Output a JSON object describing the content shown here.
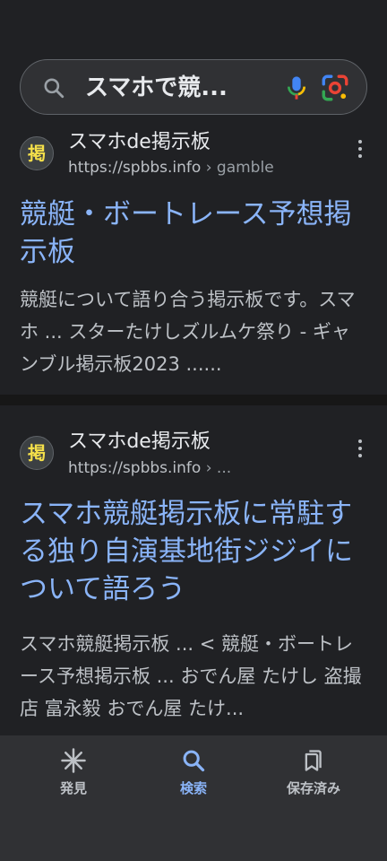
{
  "search": {
    "query": "スマホで競..."
  },
  "results": [
    {
      "favicon_text": "掲",
      "site_name": "スマホde掲示板",
      "url": "https://spbbs.info",
      "breadcrumb": " › gamble",
      "title": "競艇・ボートレース予想掲示板",
      "snippet": "競艇について語り合う掲示板です。スマホ ... スターたけしズルムケ祭り - ギャンブル掲示板2023 ......"
    },
    {
      "favicon_text": "掲",
      "site_name": "スマホde掲示板",
      "url": "https://spbbs.info",
      "breadcrumb": " › ...",
      "title": "スマホ競艇掲示板に常駐する独り自演基地街ジジイについて語ろう",
      "snippet": "スマホ競艇掲示板 ... < 競艇・ボートレース予想掲示板 ... おでん屋 たけし 盗撮店 富永毅 おでん屋 たけ..."
    }
  ],
  "bottom_nav": {
    "items": [
      {
        "label": "発見",
        "icon": "asterisk-icon",
        "active": false
      },
      {
        "label": "検索",
        "icon": "search-icon",
        "active": true
      },
      {
        "label": "保存済み",
        "icon": "saved-icon",
        "active": false
      }
    ]
  },
  "colors": {
    "background": "#202124",
    "link": "#8ab4f8",
    "text_secondary": "#bdc1c6",
    "nav_background": "#303134"
  }
}
